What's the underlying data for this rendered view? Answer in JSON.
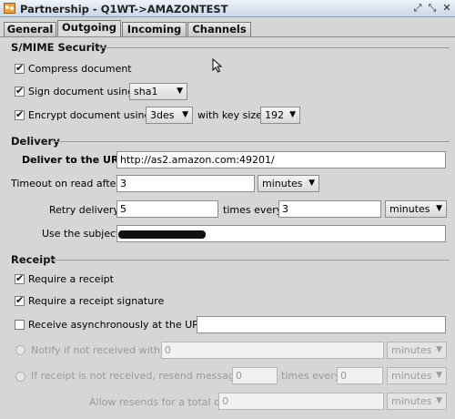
{
  "window": {
    "title": "Partnership - Q1WT->AMAZONTEST",
    "icons": [
      "partnership-icon",
      "restore-icon",
      "maximize-icon",
      "close-icon"
    ]
  },
  "tabs": [
    {
      "label": "General",
      "active": false
    },
    {
      "label": "Outgoing",
      "active": true
    },
    {
      "label": "Incoming",
      "active": false
    },
    {
      "label": "Channels",
      "active": false
    }
  ],
  "smime": {
    "title": "S/MIME Security",
    "compress": {
      "label": "Compress document",
      "checked": true
    },
    "sign": {
      "label": "Sign document using",
      "checked": true,
      "algorithm": "sha1"
    },
    "encrypt": {
      "label": "Encrypt document using",
      "checked": true,
      "algorithm": "3des",
      "keysize_label": "with key size",
      "keysize": "192"
    }
  },
  "delivery": {
    "title": "Delivery",
    "url_label": "Deliver to the URL",
    "url_value": "http://as2.amazon.com:49201/",
    "timeout_label": "Timeout on read after",
    "timeout_value": "3",
    "timeout_unit": "minutes",
    "retry_label": "Retry delivery",
    "retry_value": "5",
    "retry_every_label": "times every",
    "retry_every_value": "3",
    "retry_unit": "minutes",
    "subject_label": "Use the subject",
    "subject_value": ""
  },
  "receipt": {
    "title": "Receipt",
    "require": {
      "label": "Require a receipt",
      "checked": true
    },
    "require_sig": {
      "label": "Require a receipt signature",
      "checked": true
    },
    "async": {
      "label": "Receive asynchronously at the URL",
      "checked": false,
      "value": ""
    },
    "notify": {
      "label": "Notify if not received within",
      "value": "0",
      "unit": "minutes"
    },
    "resend": {
      "label": "If receipt is not received, resend message",
      "value": "0",
      "every_label": "times every",
      "every_value": "0",
      "unit": "minutes"
    },
    "allow": {
      "label": "Allow resends for a total of",
      "value": "0",
      "unit": "minutes"
    }
  },
  "colors": {
    "titlebar": "#c9d7e8",
    "panel": "#d6d6d6",
    "accent": "#111111"
  }
}
